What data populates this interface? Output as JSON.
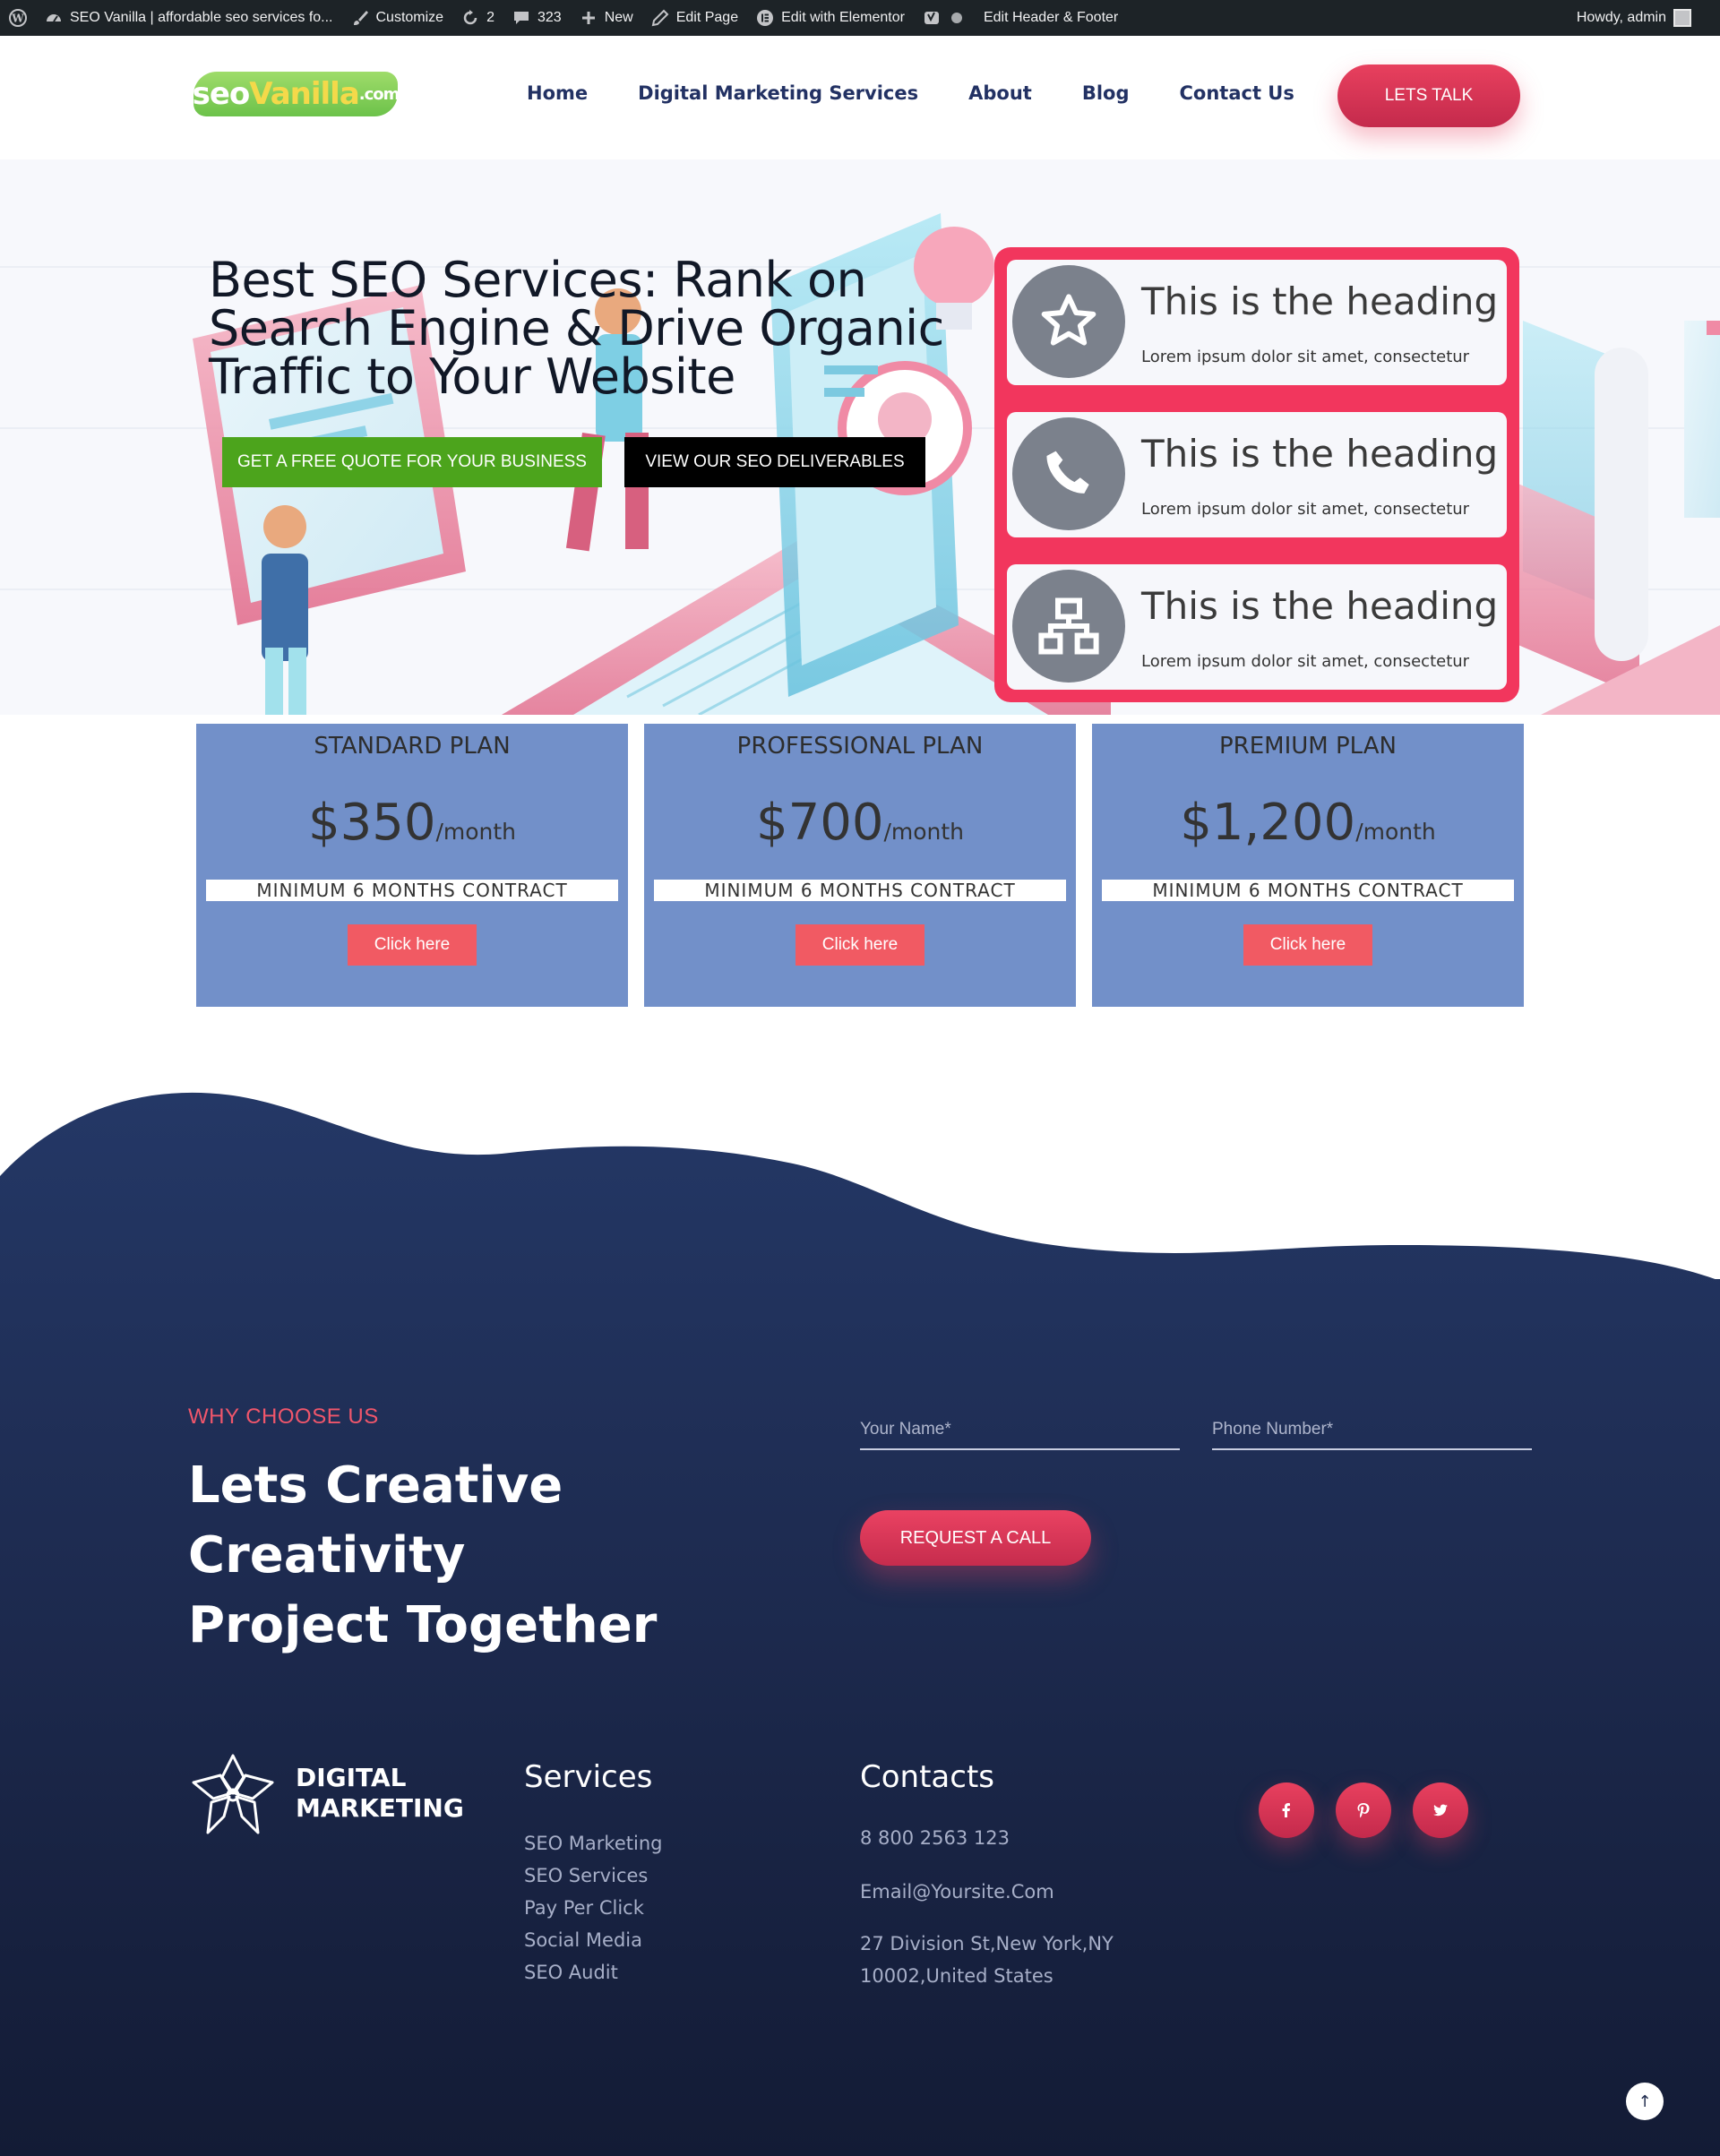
{
  "admin_bar": {
    "site_title": "SEO Vanilla | affordable seo services fo...",
    "customize": "Customize",
    "updates_count": "2",
    "comments_count": "323",
    "new": "New",
    "edit_page": "Edit Page",
    "edit_elementor": "Edit with Elementor",
    "edit_header_footer": "Edit Header & Footer",
    "howdy": "Howdy, admin",
    "icons": [
      "wordpress-icon",
      "dashboard-icon",
      "brush-icon",
      "refresh-icon",
      "comment-icon",
      "plus-icon",
      "pencil-icon",
      "elementor-icon",
      "yoast-icon",
      "status-dot-icon",
      "avatar"
    ]
  },
  "header": {
    "logo": {
      "seo": "seo",
      "vanilla": "Vanilla",
      "com": ".com"
    },
    "nav": [
      {
        "label": "Home"
      },
      {
        "label": "Digital Marketing Services"
      },
      {
        "label": "About"
      },
      {
        "label": "Blog"
      },
      {
        "label": "Contact Us"
      }
    ],
    "cta": "LETS TALK"
  },
  "hero": {
    "title": "Best SEO Services: Rank on Search Engine & Drive Organic Traffic to Your Website",
    "btn_quote": "GET A FREE QUOTE FOR YOUR BUSINESS",
    "btn_deliverables": "VIEW OUR SEO DELIVERABLES",
    "features": [
      {
        "icon": "star-icon",
        "heading": "This is the heading",
        "text": "Lorem ipsum dolor sit amet, consectetur"
      },
      {
        "icon": "phone-icon",
        "heading": "This is the heading",
        "text": "Lorem ipsum dolor sit amet, consectetur"
      },
      {
        "icon": "sitemap-icon",
        "heading": "This is the heading",
        "text": "Lorem ipsum dolor sit amet, consectetur"
      }
    ]
  },
  "pricing": {
    "plans": [
      {
        "name": "STANDARD PLAN",
        "price": "$350",
        "period": "/month",
        "contract": "MINIMUM 6 MONTHS CONTRACT",
        "button": "Click here"
      },
      {
        "name": "PROFESSIONAL PLAN",
        "price": "$700",
        "period": "/month",
        "contract": "MINIMUM 6 MONTHS CONTRACT",
        "button": "Click here"
      },
      {
        "name": "PREMIUM PLAN",
        "price": "$1,200",
        "period": "/month",
        "contract": "MINIMUM 6 MONTHS CONTRACT",
        "button": "Click here"
      }
    ]
  },
  "why": {
    "label": "WHY CHOOSE US",
    "title_line1": "Lets Creative Creativity",
    "title_line2": "Project Together",
    "name_placeholder": "Your Name*",
    "phone_placeholder": "Phone Number*",
    "button": "REQUEST A CALL"
  },
  "footer": {
    "brand_line1": "DIGITAL",
    "brand_line2": "MARKETING",
    "services_title": "Services",
    "services": [
      "SEO Marketing",
      "SEO Services",
      "Pay Per Click",
      "Social Media",
      "SEO Audit"
    ],
    "contacts_title": "Contacts",
    "phone": "8 800 2563 123",
    "email": "Email@Yoursite.Com",
    "address_line1": "27 Division St,New York,NY",
    "address_line2": "10002,United States",
    "socials": [
      "facebook-icon",
      "pinterest-icon",
      "twitter-icon"
    ],
    "back_to_top": "↑"
  },
  "colors": {
    "accent": "#f2365d",
    "navy": "#223163",
    "plan_bg": "#7290c9",
    "green": "#4ca41c",
    "dark_bg": "#1e2c52"
  }
}
